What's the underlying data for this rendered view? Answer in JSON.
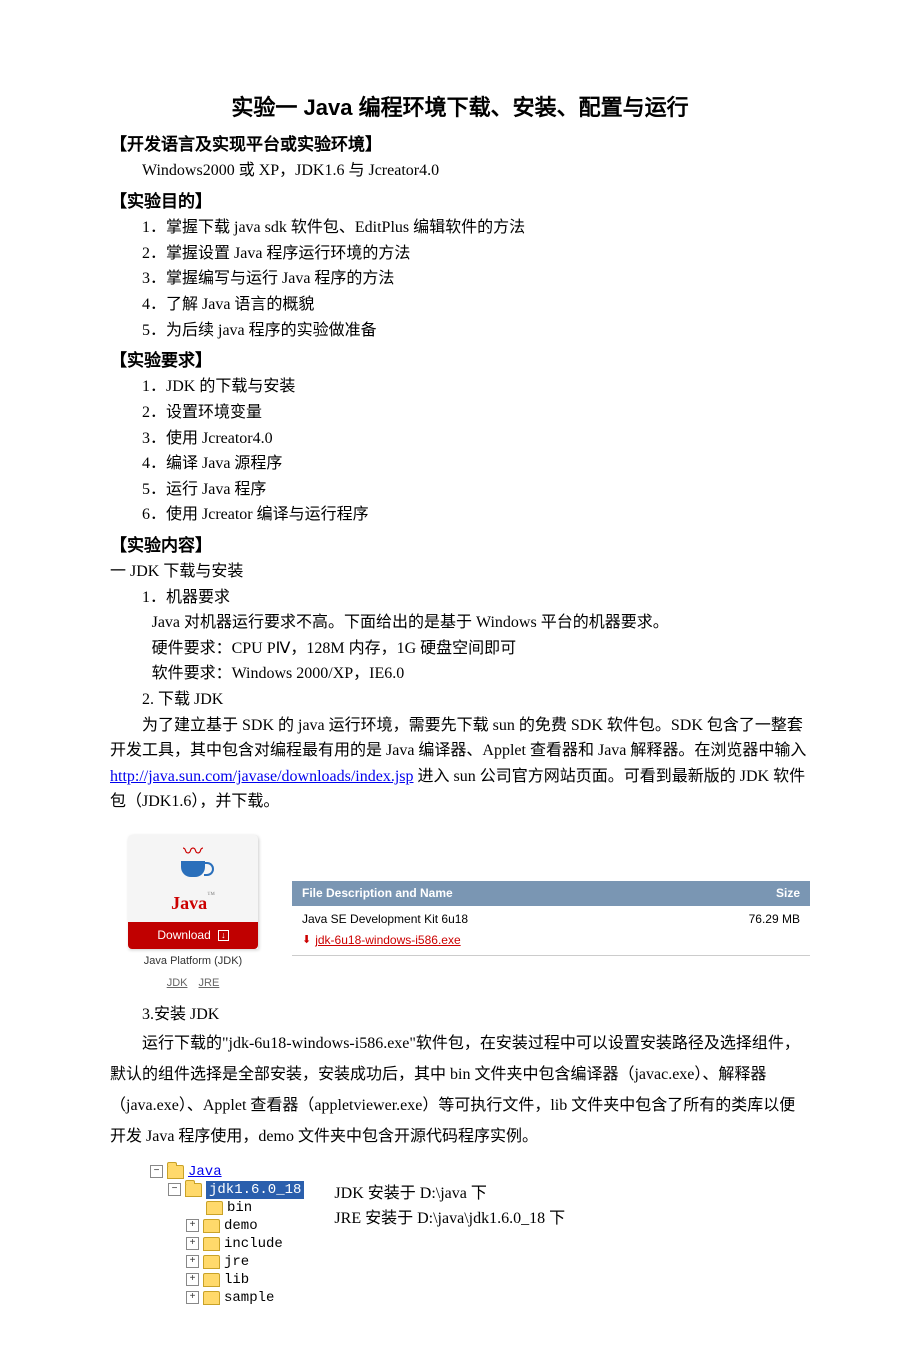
{
  "title": "实验一   Java 编程环境下载、安装、配置与运行",
  "sections": {
    "env_head": "【开发语言及实现平台或实验环境】",
    "env_text": "Windows2000 或 XP，JDK1.6 与 Jcreator4.0",
    "goal_head": "【实验目的】",
    "goals": [
      "1．掌握下载 java sdk 软件包、EditPlus 编辑软件的方法",
      "2．掌握设置 Java 程序运行环境的方法",
      "3．掌握编写与运行 Java 程序的方法",
      "4．了解 Java 语言的概貌",
      "5．为后续 java 程序的实验做准备"
    ],
    "req_head": "【实验要求】",
    "reqs": [
      "1．JDK 的下载与安装",
      "2．设置环境变量",
      "3．使用 Jcreator4.0",
      "4．编译 Java 源程序",
      "5．运行 Java 程序",
      "6．使用 Jcreator 编译与运行程序"
    ],
    "content_head": "【实验内容】",
    "content_h1": "一 JDK 下载与安装",
    "c1_1": "1．机器要求",
    "c1_1a": "Java 对机器运行要求不高。下面给出的是基于 Windows 平台的机器要求。",
    "c1_1b": "硬件要求：CPU PⅣ，128M 内存，1G 硬盘空间即可",
    "c1_1c": "软件要求：Windows 2000/XP，IE6.0",
    "c1_2": "2. 下载 JDK",
    "c1_2a_pre": "为了建立基于 SDK 的 java 运行环境，需要先下载 sun 的免费 SDK 软件包。SDK 包含了一整套开发工具，其中包含对编程最有用的是 Java 编译器、Applet 查看器和 Java 解释器。在浏览器中输入 ",
    "c1_2a_link": "http://java.sun.com/javase/downloads/index.jsp",
    "c1_2a_post": " 进入 sun 公司官方网站页面。可看到最新版的 JDK 软件包（JDK1.6），并下载。",
    "c1_3": "3.安装 JDK",
    "c1_3a": "运行下载的\"jdk-6u18-windows-i586.exe\"软件包，在安装过程中可以设置安装路径及选择组件，默认的组件选择是全部安装，安装成功后，其中 bin 文件夹中包含编译器（javac.exe）、解释器（java.exe）、Applet 查看器（appletviewer.exe）等可执行文件，lib 文件夹中包含了所有的类库以便开发 Java 程序使用，demo 文件夹中包含开源代码程序实例。"
  },
  "java_card": {
    "brand": "Java",
    "download": "Download",
    "caption": "Java Platform (JDK)",
    "link_jdk": "JDK",
    "link_jre": "JRE"
  },
  "file_table": {
    "col_desc": "File Description and Name",
    "col_size": "Size",
    "desc": "Java SE Development Kit 6u18",
    "file": "jdk-6u18-windows-i586.exe",
    "size": "76.29 MB"
  },
  "tree": {
    "root": "Java",
    "sel": "jdk1.6.0_18",
    "children": [
      "bin",
      "demo",
      "include",
      "jre",
      "lib",
      "sample"
    ]
  },
  "tree_notes": {
    "n1": "JDK 安装于 D:\\java 下",
    "n2": "JRE 安装于 D:\\java\\jdk1.6.0_18 下"
  }
}
